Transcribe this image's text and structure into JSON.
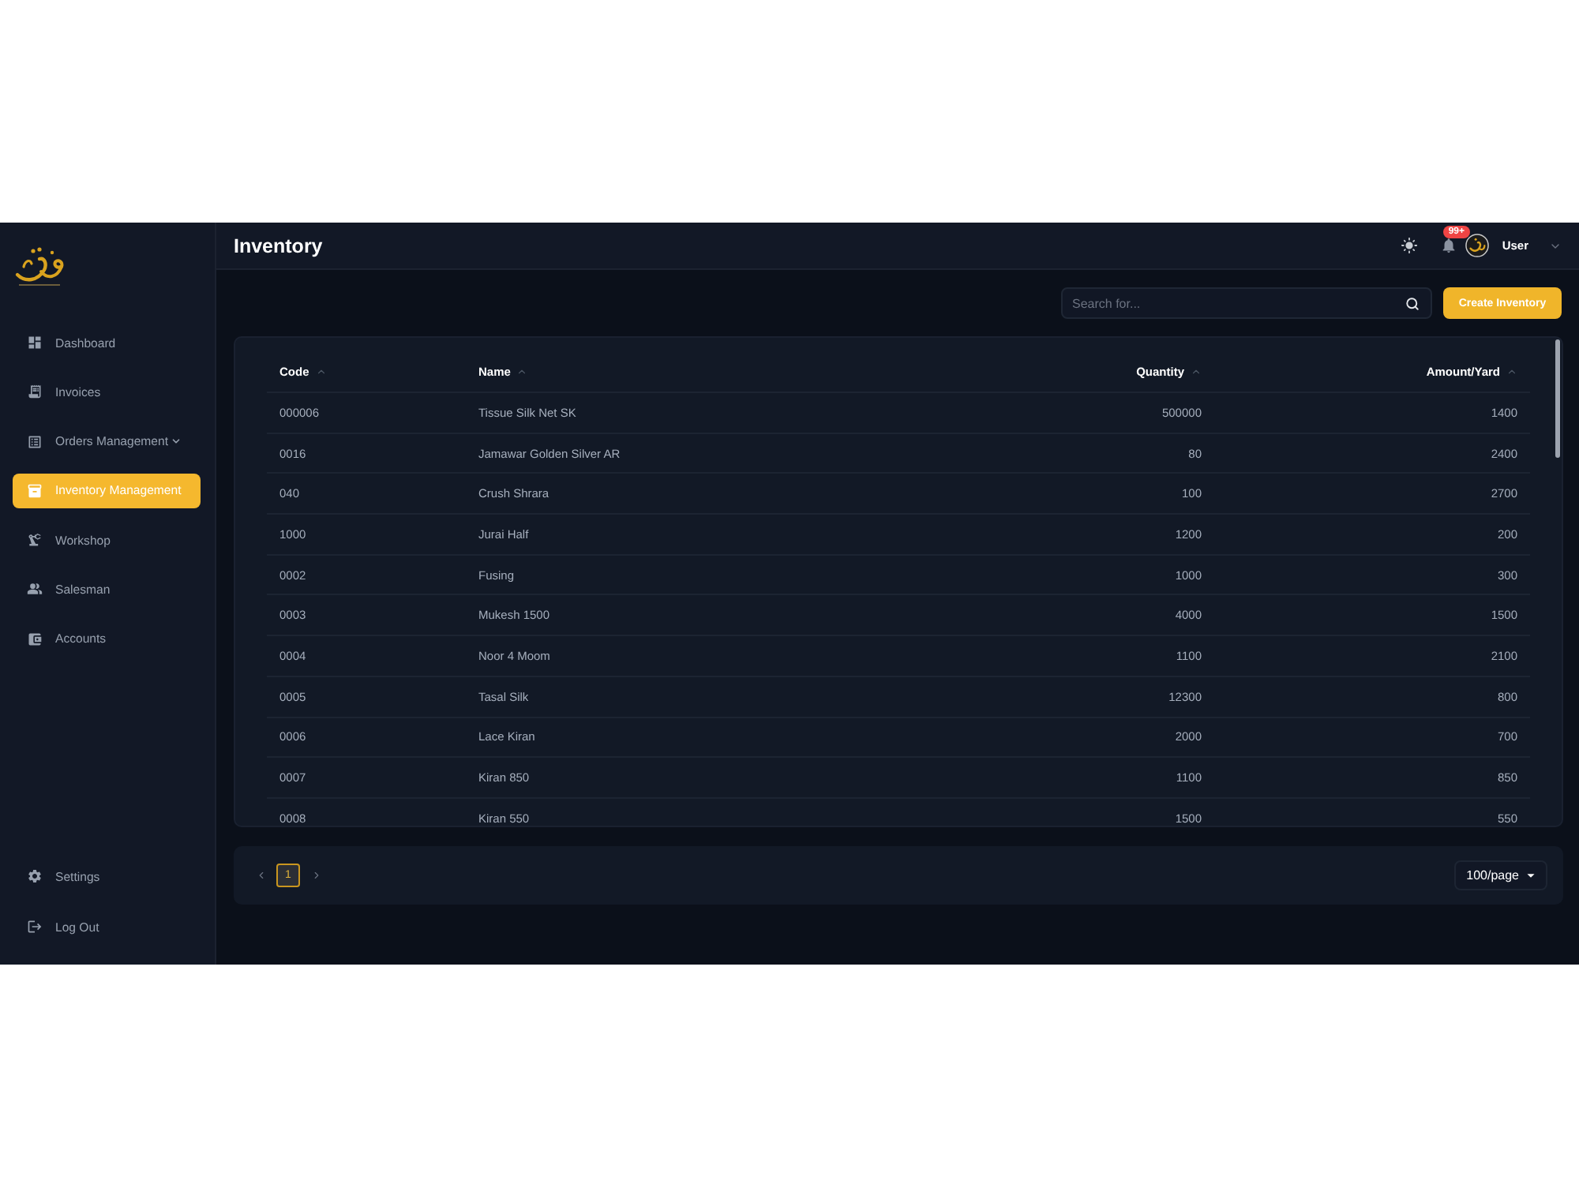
{
  "sidebar": {
    "items": [
      {
        "label": "Dashboard",
        "selected": false,
        "expandable": false
      },
      {
        "label": "Invoices",
        "selected": false,
        "expandable": false
      },
      {
        "label": "Orders Management",
        "selected": false,
        "expandable": true
      },
      {
        "label": "Inventory Management",
        "selected": true,
        "expandable": false
      },
      {
        "label": "Workshop",
        "selected": false,
        "expandable": false
      },
      {
        "label": "Salesman",
        "selected": false,
        "expandable": false
      },
      {
        "label": "Accounts",
        "selected": false,
        "expandable": false
      }
    ],
    "footer_items": [
      {
        "label": "Settings"
      },
      {
        "label": "Log Out"
      }
    ]
  },
  "header": {
    "title": "Inventory",
    "notifications": {
      "badge": "99+"
    },
    "user": {
      "name": "User"
    }
  },
  "toolbar": {
    "search": {
      "placeholder": "Search for..."
    },
    "create_button": "Create Inventory"
  },
  "table": {
    "columns": [
      {
        "label": "Code",
        "kind": "text",
        "sortable": true
      },
      {
        "label": "Name",
        "kind": "text",
        "sortable": true
      },
      {
        "label": "Quantity",
        "kind": "number",
        "sortable": true
      },
      {
        "label": "Amount/Yard",
        "kind": "number",
        "sortable": true
      }
    ],
    "rows": [
      [
        "000006",
        "Tissue Silk Net SK",
        "500000",
        "1400"
      ],
      [
        "0016",
        "Jamawar Golden Silver AR",
        "80",
        "2400"
      ],
      [
        "040",
        "Crush Shrara",
        "100",
        "2700"
      ],
      [
        "1000",
        "Jurai Half",
        "1200",
        "200"
      ],
      [
        "0002",
        "Fusing",
        "1000",
        "300"
      ],
      [
        "0003",
        "Mukesh 1500",
        "4000",
        "1500"
      ],
      [
        "0004",
        "Noor 4 Moom",
        "1100",
        "2100"
      ],
      [
        "0005",
        "Tasal Silk",
        "12300",
        "800"
      ],
      [
        "0006",
        "Lace Kiran",
        "2000",
        "700"
      ],
      [
        "0007",
        "Kiran 850",
        "1100",
        "850"
      ],
      [
        "0008",
        "Kiran 550",
        "1500",
        "550"
      ]
    ]
  },
  "pagination": {
    "pages": [
      {
        "label": "1",
        "selected": true
      }
    ],
    "page_size": "100/page"
  }
}
